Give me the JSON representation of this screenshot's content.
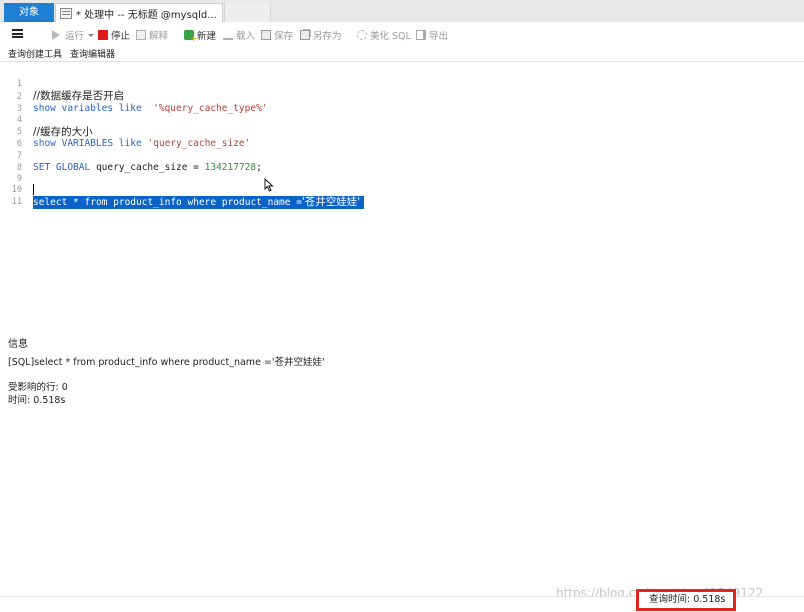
{
  "tabs": {
    "objects_label": "对象",
    "query_label": "* 处理中 -- 无标题 @mysqld..."
  },
  "toolbar": {
    "run_label": "运行",
    "stop_label": "停止",
    "explain_label": "解释",
    "new_label": "新建",
    "load_label": "载入",
    "save_label": "保存",
    "saveas_label": "另存为",
    "beautify_label": "美化 SQL",
    "export_label": "导出"
  },
  "subtabs": {
    "builder_label": "查询创建工具",
    "editor_label": "查询编辑器"
  },
  "editor": {
    "lines": [
      {
        "num": "1",
        "text": "//数据缓存是否开启"
      },
      {
        "num": "2",
        "kw1": "show variables like",
        "str": "'%query_cache_type%'"
      },
      {
        "num": "3"
      },
      {
        "num": "4",
        "text": "//缓存的大小"
      },
      {
        "num": "5",
        "kw1": "show VARIABLES like",
        "str": "'query_cache_size'"
      },
      {
        "num": "6"
      },
      {
        "num": "7",
        "kw1": "SET GLOBAL",
        "plain": "query_cache_size =",
        "numval": "134217728",
        "tail": ";"
      },
      {
        "num": "8"
      },
      {
        "num": "9"
      },
      {
        "num": "10",
        "kw1": "select",
        "plain": " * ",
        "kw2": "from",
        "plain2": "product_info",
        "kw3": "where",
        "plain3": "product_name =",
        "str": "'苍井空娃娃'"
      },
      {
        "num": "11"
      }
    ]
  },
  "info": {
    "title": "信息",
    "sql_line": "[SQL]select  * from product_info where product_name ='苍井空娃娃'",
    "affected_rows": "受影响的行: 0",
    "time": "时间: 0.518s"
  },
  "status": {
    "query_time": "查询时间: 0.518s"
  },
  "watermark": "https://blog.csdn.net/m_42549122",
  "colors": {
    "accent": "#1e7fd4",
    "selection": "#0a63c9",
    "highlight_box": "#e0251f",
    "stop": "#e01b1b"
  }
}
